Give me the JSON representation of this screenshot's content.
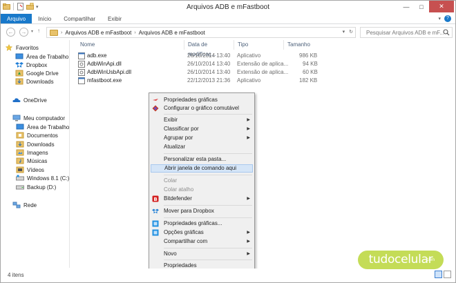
{
  "window": {
    "title": "Arquivos ADB e mFastboot"
  },
  "ribbon": {
    "tabs": [
      "Arquivo",
      "Início",
      "Compartilhar",
      "Exibir"
    ]
  },
  "address": {
    "breadcrumb": [
      "Arquivos ADB e mFastboot",
      "Arquivos ADB e mFastboot"
    ],
    "search_placeholder": "Pesquisar Arquivos ADB e mF..."
  },
  "sidebar": {
    "favorites_label": "Favoritos",
    "favorites": [
      "Área de Trabalho",
      "Dropbox",
      "Google Drive",
      "Downloads"
    ],
    "onedrive": "OneDrive",
    "computer_label": "Meu computador",
    "computer": [
      "Área de Trabalho",
      "Documentos",
      "Downloads",
      "Imagens",
      "Músicas",
      "Vídeos",
      "Windows 8.1 (C:)",
      "Backup (D:)"
    ],
    "network": "Rede"
  },
  "filelist": {
    "columns": [
      "Nome",
      "Data de modificaç...",
      "Tipo",
      "Tamanho"
    ],
    "rows": [
      {
        "name": "adb.exe",
        "date": "26/10/2014 13:40",
        "type": "Aplicativo",
        "size": "986 KB"
      },
      {
        "name": "AdbWinApi.dll",
        "date": "26/10/2014 13:40",
        "type": "Extensão de aplica...",
        "size": "94 KB"
      },
      {
        "name": "AdbWinUsbApi.dll",
        "date": "26/10/2014 13:40",
        "type": "Extensão de aplica...",
        "size": "60 KB"
      },
      {
        "name": "mfastboot.exe",
        "date": "22/12/2013 21:36",
        "type": "Aplicativo",
        "size": "182 KB"
      }
    ]
  },
  "context_menu": {
    "items": [
      "Propriedades gráficas",
      "Configurar o gráfico comutável",
      "Exibir",
      "Classificar por",
      "Agrupar por",
      "Atualizar",
      "Personalizar esta pasta...",
      "Abrir janela de comando aqui",
      "Colar",
      "Colar atalho",
      "Bitdefender",
      "Mover para Dropbox",
      "Propriedades gráficas...",
      "Opções gráficas",
      "Compartilhar com",
      "Novo",
      "Propriedades"
    ]
  },
  "status": {
    "count": "4 itens"
  },
  "watermark": {
    "text": "tudocelular",
    "suffix": ".com"
  }
}
